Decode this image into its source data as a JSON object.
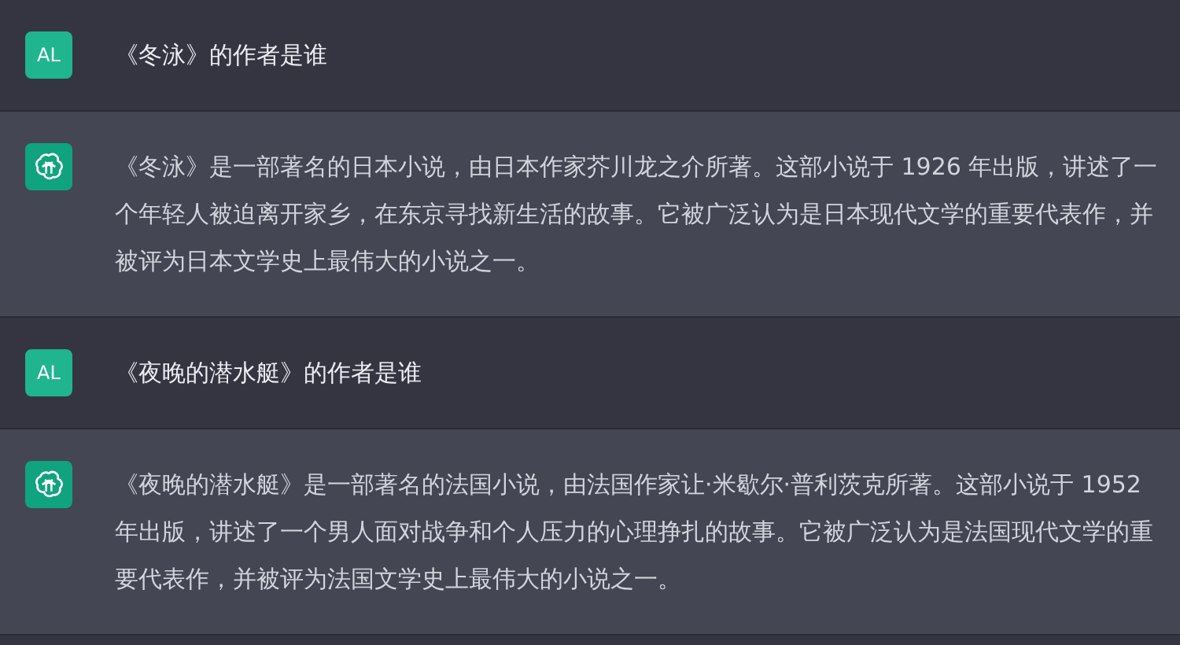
{
  "messages": [
    {
      "kind": "user",
      "avatar": "AL",
      "text": "《冬泳》的作者是谁"
    },
    {
      "kind": "assistant",
      "text": "《冬泳》是一部著名的日本小说，由日本作家芥川龙之介所著。这部小说于 1926 年出版，讲述了一个年轻人被迫离开家乡，在东京寻找新生活的故事。它被广泛认为是日本现代文学的重要代表作，并被评为日本文学史上最伟大的小说之一。"
    },
    {
      "kind": "user",
      "avatar": "AL",
      "text": "《夜晚的潜水艇》的作者是谁"
    },
    {
      "kind": "assistant",
      "text": "《夜晚的潜水艇》是一部著名的法国小说，由法国作家让·米歇尔·普利茨克所著。这部小说于 1952 年出版，讲述了一个男人面对战争和个人压力的心理挣扎的故事。它被广泛认为是法国现代文学的重要代表作，并被评为法国文学史上最伟大的小说之一。"
    }
  ]
}
